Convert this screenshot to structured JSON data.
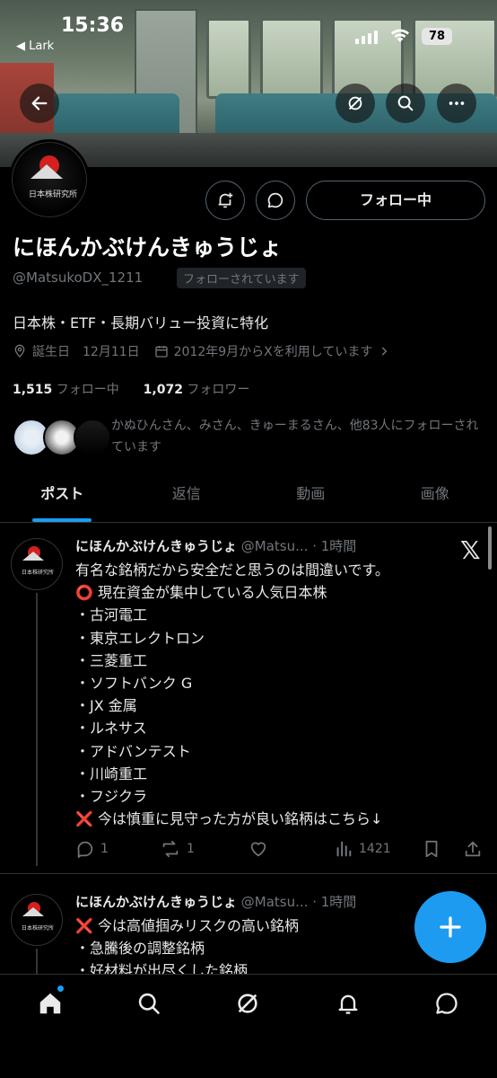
{
  "status_bar": {
    "time": "15:36",
    "back_app": "◀ Lark",
    "battery": "78"
  },
  "profile": {
    "display_name": "にほんかぶけんきゅうじょ",
    "handle": "@MatsukoDX_1211",
    "follows_you_badge": "フォローされています",
    "bio": "日本株・ETF・長期バリュー投資に特化",
    "birthday_label": "誕生日",
    "birthday_value": "12月11日",
    "joined": "2012年9月からXを利用しています",
    "following_count": "1,515",
    "following_label": "フォロー中",
    "followers_count": "1,072",
    "followers_label": "フォロワー",
    "followed_by_text": "かぬひんさん、みさん、きゅーまるさん、他83人にフォローされています",
    "follow_button": "フォロー中",
    "avatar_brand": "日本株研究所"
  },
  "tabs": [
    {
      "label": "ポスト",
      "active": true
    },
    {
      "label": "返信",
      "active": false
    },
    {
      "label": "動画",
      "active": false
    },
    {
      "label": "画像",
      "active": false
    }
  ],
  "posts": [
    {
      "author": "にほんかぶけんきゅうじょ",
      "handle_time": "@Matsu... · 1時間",
      "lines": [
        "有名な銘柄だから安全だと思うのは間違いです。",
        "⭕ 現在資金が集中している人気日本株",
        "・古河電工",
        "・東京エレクトロン",
        "・三菱重工",
        "・ソフトバンク G",
        "・JX 金属",
        "・ルネサス",
        "・アドバンテスト",
        "・川崎重工",
        "・フジクラ",
        "❌ 今は慎重に見守った方が良い銘柄はこちら↓"
      ],
      "replies": "1",
      "reposts": "1",
      "views": "1421"
    },
    {
      "author": "にほんかぶけんきゅうじょ",
      "handle_time": "@Matsu... · 1時間",
      "lines": [
        "❌ 今は高値掴みリスクの高い銘柄",
        "・急騰後の調整銘柄",
        "・好材料が出尽くした銘柄"
      ]
    }
  ],
  "colors": {
    "accent": "#1d9bf0",
    "background": "#000000",
    "secondary_text": "#71767b",
    "border": "#2f3336"
  },
  "icons": [
    "back-arrow-icon",
    "grok-icon",
    "search-icon",
    "more-icon",
    "notification-bell-icon",
    "message-icon",
    "location-icon",
    "calendar-icon",
    "chevron-right-icon",
    "x-logo-icon",
    "reply-icon",
    "repost-icon",
    "like-icon",
    "views-icon",
    "bookmark-icon",
    "share-icon",
    "compose-plus-icon",
    "home-icon",
    "explore-icon",
    "grok-nav-icon",
    "notifications-icon",
    "messages-icon"
  ]
}
